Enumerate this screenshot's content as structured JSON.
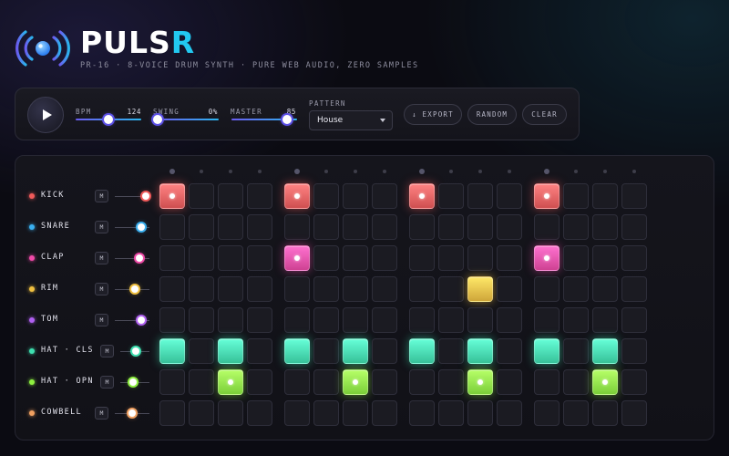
{
  "header": {
    "brand_main": "PULS",
    "brand_accent": "R",
    "subtitle": "PR-16 · 8-VOICE DRUM SYNTH · PURE WEB AUDIO, ZERO SAMPLES"
  },
  "transport": {
    "play_label": "play",
    "knobs": [
      {
        "label": "BPM",
        "value": "124",
        "level": 0.5
      },
      {
        "label": "SWING",
        "value": "0%",
        "level": 0.0
      },
      {
        "label": "MASTER",
        "value": "85",
        "level": 0.85
      }
    ],
    "pattern": {
      "label": "PATTERN",
      "selected": "House"
    },
    "buttons": [
      {
        "label": "↓ EXPORT"
      },
      {
        "label": "RANDOM"
      },
      {
        "label": "CLEAR"
      }
    ]
  },
  "sequencer": {
    "steps": 16,
    "mute_label": "M",
    "tracks": [
      {
        "name": "KICK",
        "color": "#f05a5a",
        "volume": 0.9,
        "pattern": [
          1,
          0,
          0,
          0,
          1,
          0,
          0,
          0,
          1,
          0,
          0,
          0,
          1,
          0,
          0,
          0
        ]
      },
      {
        "name": "SNARE",
        "color": "#3ab0f0",
        "volume": 0.75,
        "pattern": [
          0,
          0,
          0,
          0,
          0,
          0,
          0,
          0,
          0,
          0,
          0,
          0,
          0,
          0,
          0,
          0
        ]
      },
      {
        "name": "CLAP",
        "color": "#f04aa8",
        "volume": 0.72,
        "pattern": [
          0,
          0,
          0,
          0,
          1,
          0,
          0,
          0,
          0,
          0,
          0,
          0,
          1,
          0,
          0,
          0
        ]
      },
      {
        "name": "RIM",
        "color": "#f0c040",
        "volume": 0.58,
        "pattern": [
          0,
          0,
          0,
          0,
          0,
          0,
          0,
          0,
          0,
          0,
          1,
          0,
          0,
          0,
          0,
          0
        ]
      },
      {
        "name": "TOM",
        "color": "#b060f0",
        "volume": 0.75,
        "pattern": [
          0,
          0,
          0,
          0,
          0,
          0,
          0,
          0,
          0,
          0,
          0,
          0,
          0,
          0,
          0,
          0
        ]
      },
      {
        "name": "HAT · CLS",
        "color": "#3ee0b0",
        "volume": 0.52,
        "pattern": [
          1,
          0,
          1,
          0,
          1,
          0,
          1,
          0,
          1,
          0,
          1,
          0,
          1,
          0,
          1,
          0
        ]
      },
      {
        "name": "HAT · OPN",
        "color": "#8ef040",
        "volume": 0.45,
        "pattern": [
          0,
          0,
          1,
          0,
          0,
          0,
          1,
          0,
          0,
          0,
          1,
          0,
          0,
          0,
          1,
          0
        ]
      },
      {
        "name": "COWBELL",
        "color": "#f0a060",
        "volume": 0.5,
        "pattern": [
          0,
          0,
          0,
          0,
          0,
          0,
          0,
          0,
          0,
          0,
          0,
          0,
          0,
          0,
          0,
          0
        ]
      }
    ]
  }
}
